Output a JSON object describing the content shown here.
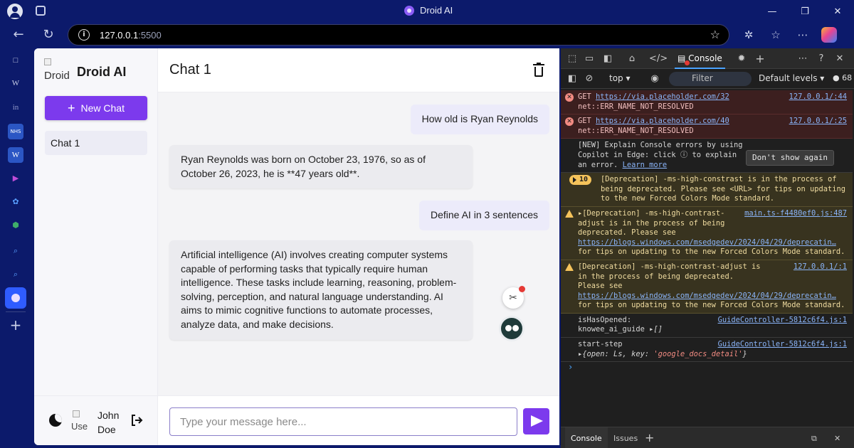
{
  "browser": {
    "tab_title": "Droid AI",
    "url_host": "127.0.0.1",
    "url_port": ":5500",
    "window_controls": [
      "—",
      "❐",
      "✕"
    ],
    "toolbar_icons": [
      "extensions-icon",
      "favorites-icon",
      "more-icon",
      "copilot-icon"
    ]
  },
  "edge_sidebar": {
    "items": [
      {
        "label": "□",
        "icon": "tabs-icon"
      },
      {
        "label": "W",
        "icon": "wikipedia-icon"
      },
      {
        "label": "in",
        "icon": "linkedin-icon"
      },
      {
        "label": "NHS",
        "icon": "nhs-icon"
      },
      {
        "label": "W",
        "icon": "word-icon"
      },
      {
        "label": "▶",
        "icon": "play-icon"
      },
      {
        "label": "✿",
        "icon": "flower-icon"
      },
      {
        "label": "⬢",
        "icon": "hexagon-icon"
      },
      {
        "label": "⌕",
        "icon": "search-icon"
      },
      {
        "label": "⌕",
        "icon": "search-icon"
      }
    ],
    "add_label": "+"
  },
  "app": {
    "brand_alt": "Droid",
    "brand_name": "Droid AI",
    "new_chat_label": "New Chat",
    "chats": [
      {
        "label": "Chat 1"
      }
    ],
    "user_avatar_alt": "Use",
    "user_name": "John Doe",
    "chat_title": "Chat 1",
    "input_placeholder": "Type your message here...",
    "messages": [
      {
        "role": "user",
        "text": "How old is Ryan Reynolds"
      },
      {
        "role": "assistant",
        "text": "Ryan Reynolds was born on October 23, 1976, so as of October 26, 2023, he is **47 years old**."
      },
      {
        "role": "user",
        "text": "Define AI in 3 sentences"
      },
      {
        "role": "assistant",
        "text": "Artificial intelligence (AI) involves creating computer systems capable of performing tasks that typically require human intelligence. These tasks include learning, reasoning, problem-solving, perception, and natural language understanding. AI aims to mimic cognitive functions to automate processes, analyze data, and make decisions."
      }
    ]
  },
  "devtools": {
    "console_tab": "Console",
    "context": "top",
    "filter_placeholder": "Filter",
    "levels": "Default levels",
    "issues_count": "68",
    "entries": [
      {
        "type": "err",
        "prefix": "GET ",
        "link": "https://via.placeholder.com/32",
        "detail": "net::ERR_NAME_NOT_RESOLVED",
        "src": "127.0.0.1/:44"
      },
      {
        "type": "err",
        "prefix": "GET ",
        "link": "https://via.placeholder.com/40",
        "detail": "net::ERR_NAME_NOT_RESOLVED",
        "src": "127.0.0.1/:25"
      },
      {
        "type": "tip",
        "text": "[NEW] Explain Console errors by using Copilot in Edge: click ⓘ to explain an error.",
        "link": "Learn more",
        "button": "Don't show again"
      },
      {
        "type": "warn-group",
        "count": "10",
        "text": "[Deprecation] -ms-high-constrast is in the process of being deprecated. Please see <URL> for tips on updating to the new Forced Colors Mode standard."
      },
      {
        "type": "warn",
        "text_a": "▸[Deprecation] -ms-high-contrast-adjust is in the process of being deprecated. Please see",
        "link": "https://blogs.windows.com/msedgedev/2024/04/29/deprecatin…",
        "text_b": "for tips on updating to the new Forced Colors Mode standard.",
        "src": "main.ts-f4480ef0.js:487"
      },
      {
        "type": "warn",
        "text_a": "[Deprecation] -ms-high-contrast-adjust is in the process of being deprecated. Please see",
        "link": "https://blogs.windows.com/msedgedev/2024/04/29/deprecatin…",
        "text_b": "for tips on updating to the new Forced Colors Mode standard.",
        "src": "127.0.0.1/:1"
      },
      {
        "type": "log",
        "key": "isHasOpened:",
        "key2": "knowee_ai_guide",
        "val": "▸[]",
        "src": "GuideController-5812c6f4.js:1"
      },
      {
        "type": "log",
        "key": "start-step",
        "val": "▸{open: Ls, key: ",
        "str": "'google_docs_detail'",
        "tail": "}",
        "src": "GuideController-5812c6f4.js:1"
      }
    ],
    "drawer_tabs": [
      "Console",
      "Issues"
    ]
  }
}
